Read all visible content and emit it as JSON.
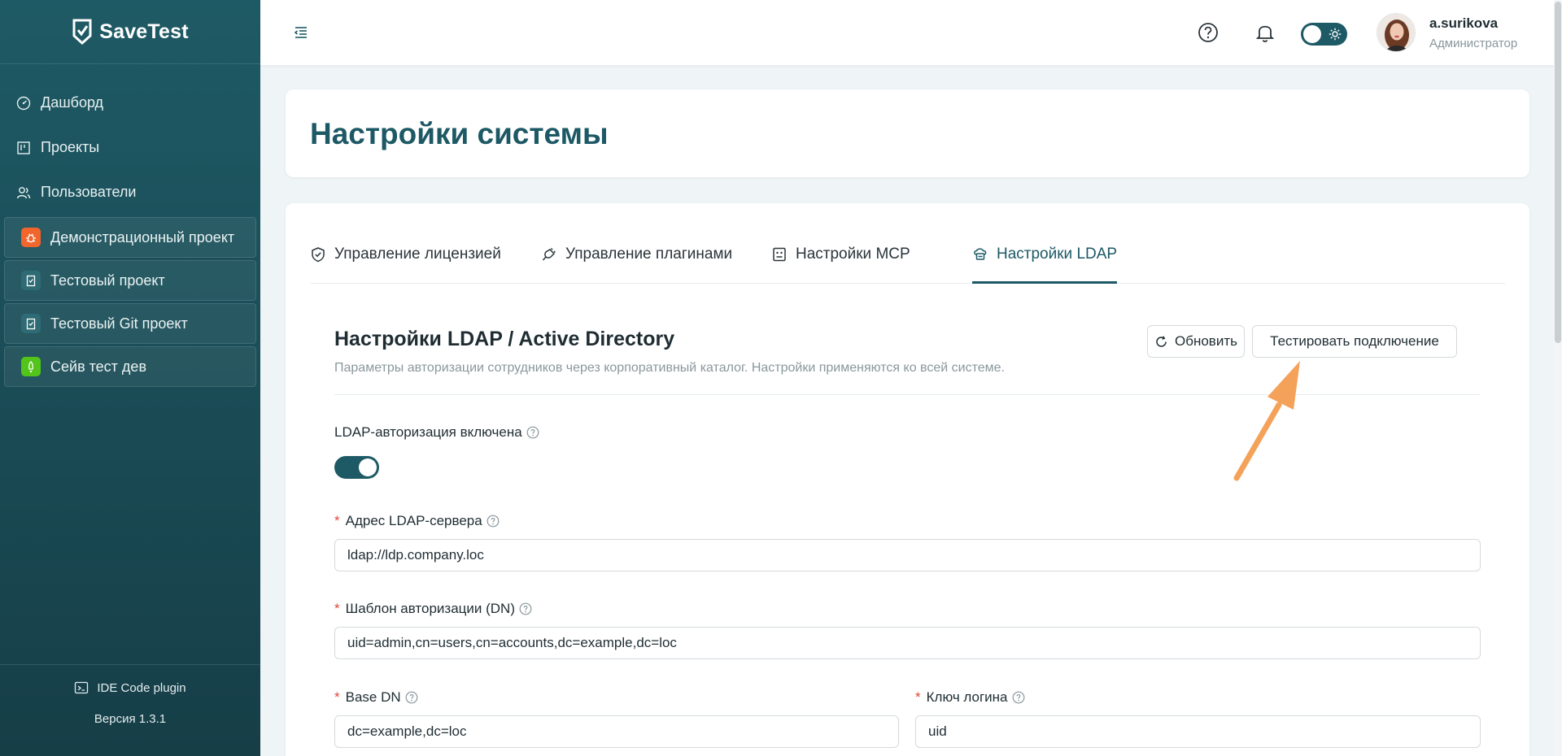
{
  "brand": {
    "name": "SaveTest"
  },
  "sidebar": {
    "nav": [
      {
        "label": "Дашборд",
        "icon": "dashboard-icon"
      },
      {
        "label": "Проекты",
        "icon": "kanban-icon"
      },
      {
        "label": "Пользователи",
        "icon": "users-icon"
      }
    ],
    "projects": [
      {
        "label": "Демонстрационный проект",
        "icon": "bug-icon",
        "color": "#f2662d"
      },
      {
        "label": "Тестовый проект",
        "icon": "clipboard-check-icon",
        "color": "#2f6b74"
      },
      {
        "label": "Тестовый Git проект",
        "icon": "clipboard-check-icon",
        "color": "#2f6b74"
      },
      {
        "label": "Сейв тест дев",
        "icon": "rocket-icon",
        "color": "#52c41a"
      }
    ],
    "ide_plugin": "IDE Code plugin",
    "version": "Версия 1.3.1"
  },
  "header": {
    "user_name": "a.surikova",
    "user_role": "Администратор"
  },
  "page": {
    "title": "Настройки системы"
  },
  "tabs": [
    {
      "label": "Управление лицензией",
      "icon": "shield-check-icon"
    },
    {
      "label": "Управление плагинами",
      "icon": "plug-icon"
    },
    {
      "label": "Настройки MCP",
      "icon": "robot-icon"
    },
    {
      "label": "Настройки LDAP",
      "icon": "cloud-server-icon",
      "active": true
    }
  ],
  "ldap": {
    "title": "Настройки LDAP / Active Directory",
    "subtitle": "Параметры авторизации сотрудников через корпоративный каталог. Настройки применяются ко всей системе.",
    "refresh_label": "Обновить",
    "test_label": "Тестировать подключение",
    "enabled_label": "LDAP-авторизация включена",
    "enabled": true,
    "server_label": "Адрес LDAP-сервера",
    "server_value": "ldap://ldp.company.loc",
    "dn_label": "Шаблон авторизации (DN)",
    "dn_value": "uid=admin,cn=users,cn=accounts,dc=example,dc=loc",
    "base_dn_label": "Base DN",
    "base_dn_value": "dc=example,dc=loc",
    "login_key_label": "Ключ логина",
    "login_key_value": "uid"
  },
  "colors": {
    "accent": "#1d5865",
    "sidebar": "#1e5a65",
    "required": "#e2463b",
    "annotation_arrow": "#f4a259"
  }
}
